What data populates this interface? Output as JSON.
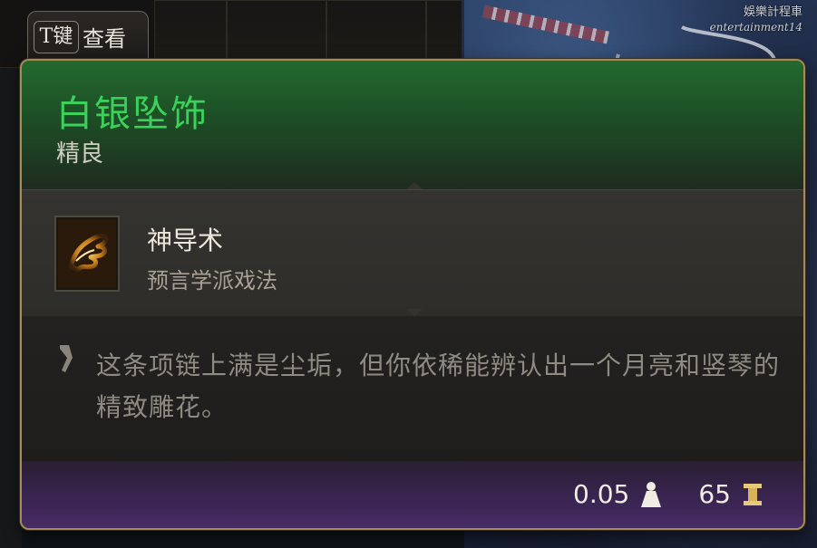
{
  "watermark": {
    "line1": "娛樂計程車",
    "line2": "entertainment14"
  },
  "key_hint": {
    "key": "T键",
    "action": "查看"
  },
  "item": {
    "name": "白银坠饰",
    "rarity": "精良",
    "rarity_color": "#3bd15a",
    "spell": {
      "name": "神导术",
      "school": "预言学派戏法",
      "icon": "guidance-hand-icon"
    },
    "description": "这条项链上满是尘垢，但你依稀能辨认出一个月亮和竖琴的精致雕花。",
    "weight": "0.05",
    "weight_icon": "weight-icon",
    "value": "65",
    "value_icon": "gold-icon"
  }
}
